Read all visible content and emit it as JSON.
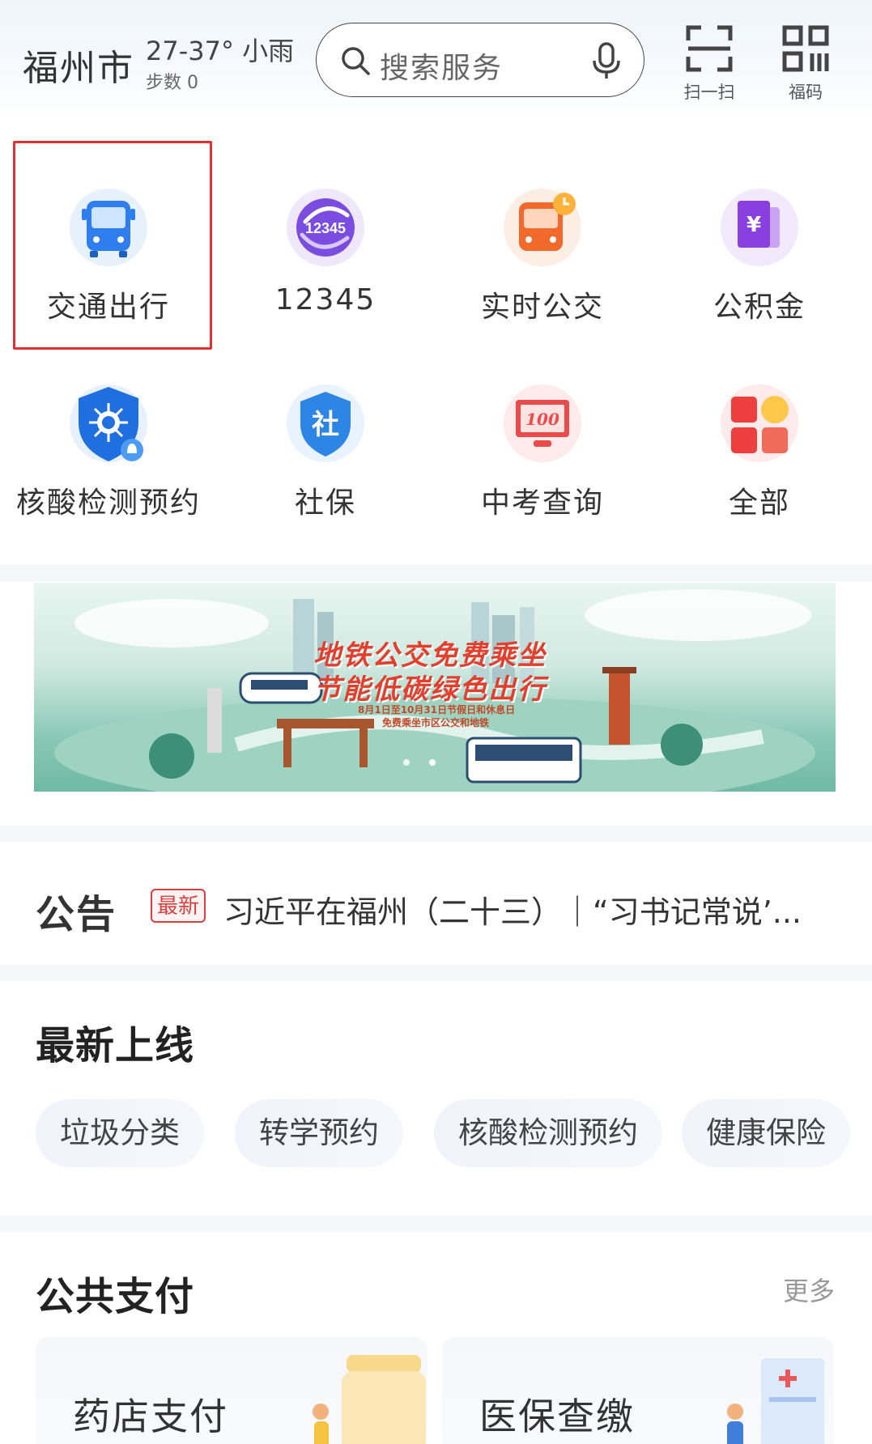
{
  "header": {
    "city": "福州市",
    "weather": "27-37° 小雨",
    "steps": "步数 0",
    "search_placeholder": "搜索服务",
    "scan_label": "扫一扫",
    "fucode_label": "福码"
  },
  "services": [
    {
      "label": "交通出行",
      "icon": "bus-icon",
      "color": "#2f7ef0"
    },
    {
      "label": "12345",
      "icon": "hotline-12345-icon",
      "color": "#7a4de0"
    },
    {
      "label": "实时公交",
      "icon": "realtime-bus-icon",
      "color": "#f26a2b"
    },
    {
      "label": "公积金",
      "icon": "yuan-fund-icon",
      "color": "#8a3fe0"
    },
    {
      "label": "核酸检测预约",
      "icon": "virus-shield-icon",
      "color": "#1f6fe0"
    },
    {
      "label": "社保",
      "icon": "social-security-icon",
      "color": "#2d86e6"
    },
    {
      "label": "中考查询",
      "icon": "exam-score-icon",
      "color": "#ea4a4a"
    },
    {
      "label": "全部",
      "icon": "all-apps-icon",
      "color": "#ee3f3f"
    }
  ],
  "banner": {
    "line1": "地铁公交免费乘坐",
    "line2": "节能低碳绿色出行",
    "line3": "8月1日至10月31日节假日和休息日",
    "line4": "免费乘坐市区公交和地铁"
  },
  "notice": {
    "title": "公告",
    "badge": "最新",
    "text": "习近平在福州（二十三）｜“习书记常说’..."
  },
  "new_online": {
    "title": "最新上线",
    "chips": [
      "垃圾分类",
      "转学预约",
      "核酸检测预约",
      "健康保险"
    ]
  },
  "public_payment": {
    "title": "公共支付",
    "more": "更多",
    "cards": [
      "药店支付",
      "医保查缴"
    ]
  },
  "colors": {
    "accent_red": "#e03030",
    "bus_blue": "#2f7ef0"
  }
}
